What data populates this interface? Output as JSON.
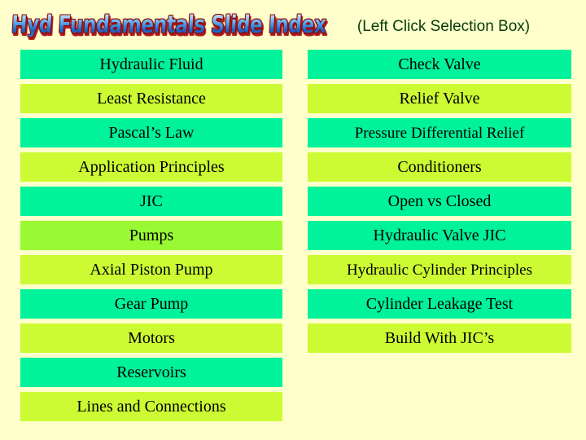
{
  "slide": {
    "background_color": "#ffffcc",
    "title": "Hyd Fundamentals Slide Index",
    "subtitle": "(Left Click Selection Box)"
  },
  "palette": {
    "spring_green": "#00f29a",
    "yellow_green": "#ccfa33",
    "lime_green": "#99fa33",
    "title_blue": "#1a62c4",
    "title_outline_red": "#8b0000",
    "subtitle_green": "#063a06",
    "label_black": "#000000"
  },
  "columns": {
    "left": {
      "items": [
        {
          "label": "Hydraulic Fluid",
          "color": "#00f29a"
        },
        {
          "label": "Least Resistance",
          "color": "#ccfa33"
        },
        {
          "label": "Pascal’s Law",
          "color": "#00f29a"
        },
        {
          "label": "Application Principles",
          "color": "#ccfa33"
        },
        {
          "label": "JIC",
          "color": "#00f29a"
        },
        {
          "label": "Pumps",
          "color": "#99fa33"
        },
        {
          "label": "Axial Piston Pump",
          "color": "#ccfa33"
        },
        {
          "label": "Gear Pump",
          "color": "#00f29a"
        },
        {
          "label": "Motors",
          "color": "#ccfa33"
        },
        {
          "label": "Reservoirs",
          "color": "#00f29a"
        },
        {
          "label": "Lines and Connections",
          "color": "#ccfa33"
        }
      ]
    },
    "right": {
      "items": [
        {
          "label": "Check Valve",
          "color": "#00f29a"
        },
        {
          "label": "Relief Valve",
          "color": "#ccfa33"
        },
        {
          "label": "Pressure Differential Relief",
          "color": "#00f29a"
        },
        {
          "label": "Conditioners",
          "color": "#ccfa33"
        },
        {
          "label": "Open vs Closed",
          "color": "#00f29a"
        },
        {
          "label": "Hydraulic Valve JIC",
          "color": "#00f29a"
        },
        {
          "label": "Hydraulic Cylinder Principles",
          "color": "#ccfa33"
        },
        {
          "label": "Cylinder Leakage Test",
          "color": "#00f29a"
        },
        {
          "label": "Build With JIC’s",
          "color": "#ccfa33"
        }
      ]
    }
  }
}
